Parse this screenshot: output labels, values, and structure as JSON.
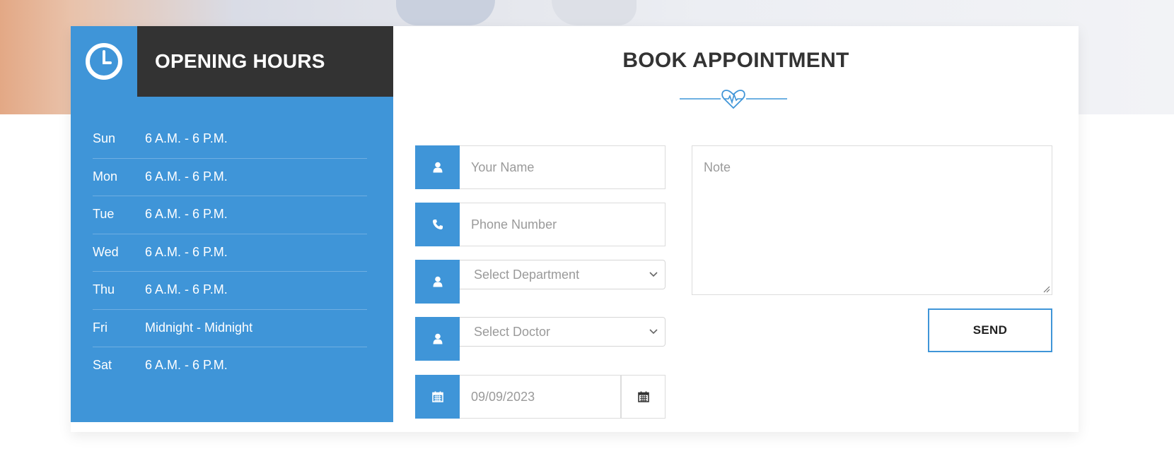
{
  "opening_hours": {
    "title": "OPENING HOURS",
    "rows": [
      {
        "day": "Sun",
        "hours": "6 A.M. - 6 P.M."
      },
      {
        "day": "Mon",
        "hours": "6 A.M. - 6 P.M."
      },
      {
        "day": "Tue",
        "hours": "6 A.M. - 6 P.M."
      },
      {
        "day": "Wed",
        "hours": "6 A.M. - 6 P.M."
      },
      {
        "day": "Thu",
        "hours": "6 A.M. - 6 P.M."
      },
      {
        "day": "Fri",
        "hours": "Midnight - Midnight"
      },
      {
        "day": "Sat",
        "hours": "6 A.M. - 6 P.M."
      }
    ]
  },
  "appointment": {
    "title": "BOOK APPOINTMENT",
    "name_placeholder": "Your Name",
    "phone_placeholder": "Phone Number",
    "department_selected": "Select Department",
    "doctor_selected": "Select Doctor",
    "date_value": "09/09/2023",
    "note_placeholder": "Note",
    "send_label": "SEND"
  },
  "icons": {
    "clock": "clock-icon",
    "user": "user-icon",
    "phone": "phone-icon",
    "calendar": "calendar-icon",
    "heart": "heartbeat-icon",
    "chevron": "chevron-down-icon"
  },
  "colors": {
    "primary": "#3f95d8",
    "dark": "#333333",
    "text": "#333333",
    "placeholder": "#9a9a9a",
    "border": "#dcdcdc"
  }
}
